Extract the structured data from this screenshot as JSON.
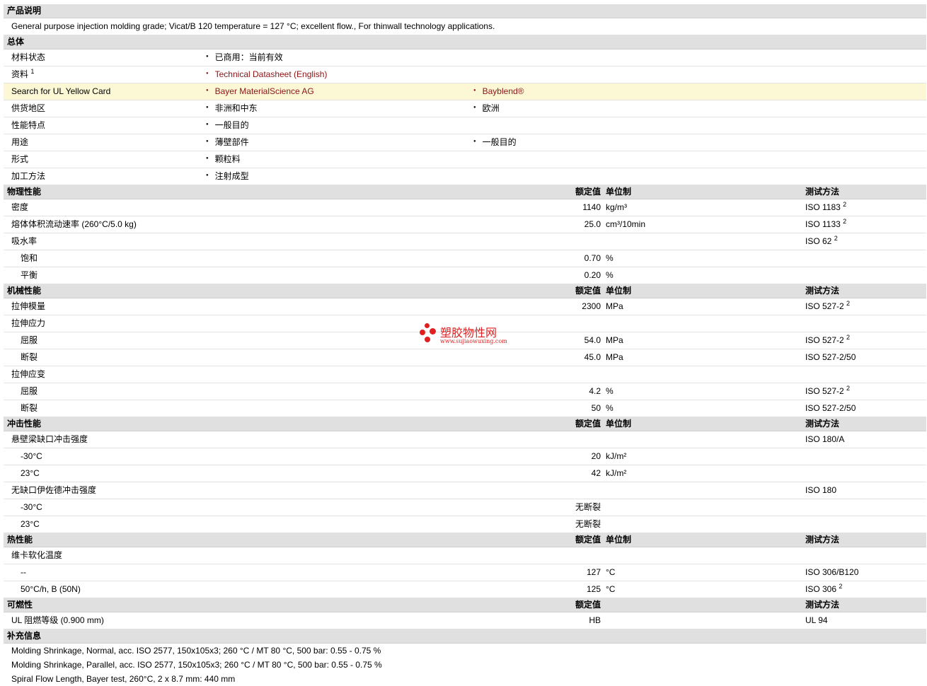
{
  "sections": {
    "desc": "产品说明",
    "general": "总体",
    "physical": "物理性能",
    "mechanical": "机械性能",
    "impact": "冲击性能",
    "thermal": "热性能",
    "flammability": "可燃性",
    "additional": "补充信息"
  },
  "headers": {
    "nominal": "额定值",
    "unit": "单位制",
    "test": "测试方法"
  },
  "description": "General purpose injection molding grade; Vicat/B 120 temperature = 127 °C; excellent flow., For thinwall technology applications.",
  "general": {
    "status_label": "材料状态",
    "status_value": "已商用：当前有效",
    "docs_label": "资料",
    "docs_sup": "1",
    "docs_value": "Technical Datasheet (English)",
    "ul_label": "Search for UL Yellow Card",
    "ul_value1": "Bayer MaterialScience AG",
    "ul_value2": "Bayblend®",
    "region_label": "供货地区",
    "region_value1": "非洲和中东",
    "region_value2": "欧洲",
    "features_label": "性能特点",
    "features_value": "一般目的",
    "uses_label": "用途",
    "uses_value1": "薄壁部件",
    "uses_value2": "一般目的",
    "form_label": "形式",
    "form_value": "颗粒料",
    "process_label": "加工方法",
    "process_value": "注射成型"
  },
  "physical": {
    "density": {
      "label": "密度",
      "value": "1140",
      "unit": "kg/m³",
      "test": "ISO 1183",
      "sup": "2"
    },
    "mvr": {
      "label": "熔体体积流动速率 (260°C/5.0 kg)",
      "value": "25.0",
      "unit": "cm³/10min",
      "test": "ISO 1133",
      "sup": "2"
    },
    "water": {
      "label": "吸水率",
      "test": "ISO 62",
      "sup": "2"
    },
    "saturation": {
      "label": "饱和",
      "value": "0.70",
      "unit": "%"
    },
    "equilibrium": {
      "label": "平衡",
      "value": "0.20",
      "unit": "%"
    }
  },
  "mechanical": {
    "modulus": {
      "label": "拉伸模量",
      "value": "2300",
      "unit": "MPa",
      "test": "ISO 527-2",
      "sup": "2"
    },
    "stress": {
      "label": "拉伸应力"
    },
    "stress_yield": {
      "label": "屈服",
      "value": "54.0",
      "unit": "MPa",
      "test": "ISO 527-2",
      "sup": "2"
    },
    "stress_break": {
      "label": "断裂",
      "value": "45.0",
      "unit": "MPa",
      "test": "ISO 527-2/50"
    },
    "strain": {
      "label": "拉伸应变"
    },
    "strain_yield": {
      "label": "屈服",
      "value": "4.2",
      "unit": "%",
      "test": "ISO 527-2",
      "sup": "2"
    },
    "strain_break": {
      "label": "断裂",
      "value": "50",
      "unit": "%",
      "test": "ISO 527-2/50"
    }
  },
  "impact": {
    "izod": {
      "label": "悬壁梁缺口冲击强度",
      "test": "ISO 180/A"
    },
    "izod_m30": {
      "label": "-30°C",
      "value": "20",
      "unit": "kJ/m²"
    },
    "izod_23": {
      "label": "23°C",
      "value": "42",
      "unit": "kJ/m²"
    },
    "unnotched": {
      "label": "无缺口伊佐德冲击强度",
      "test": "ISO 180"
    },
    "un_m30": {
      "label": "-30°C",
      "value": "无断裂"
    },
    "un_23": {
      "label": "23°C",
      "value": "无断裂"
    }
  },
  "thermal": {
    "vicat": {
      "label": "维卡软化温度"
    },
    "vicat1": {
      "label": "--",
      "value": "127",
      "unit": "°C",
      "test": "ISO 306/B120"
    },
    "vicat2": {
      "label": "50°C/h, B (50N)",
      "value": "125",
      "unit": "°C",
      "test": "ISO 306",
      "sup": "2"
    }
  },
  "flammability": {
    "ul": {
      "label": "UL 阻燃等级 (0.900 mm)",
      "value": "HB",
      "test": "UL 94"
    }
  },
  "additional": [
    "Molding Shrinkage, Normal, acc. ISO 2577, 150x105x3; 260 °C / MT 80 °C, 500 bar: 0.55 - 0.75 %",
    "Molding Shrinkage, Parallel, acc. ISO 2577, 150x105x3; 260 °C / MT 80 °C, 500 bar: 0.55 - 0.75 %",
    "Spiral Flow Length, Bayer test, 260°C, 2 x 8.7 mm: 440 mm"
  ],
  "watermark": {
    "title": "塑胶物性网",
    "url": "www.sujiaowuxing.com"
  },
  "colors": {
    "section_bg": "#e0e0e0",
    "highlight_bg": "#fcf8d6",
    "link": "#8b1414",
    "watermark": "#e02020"
  }
}
